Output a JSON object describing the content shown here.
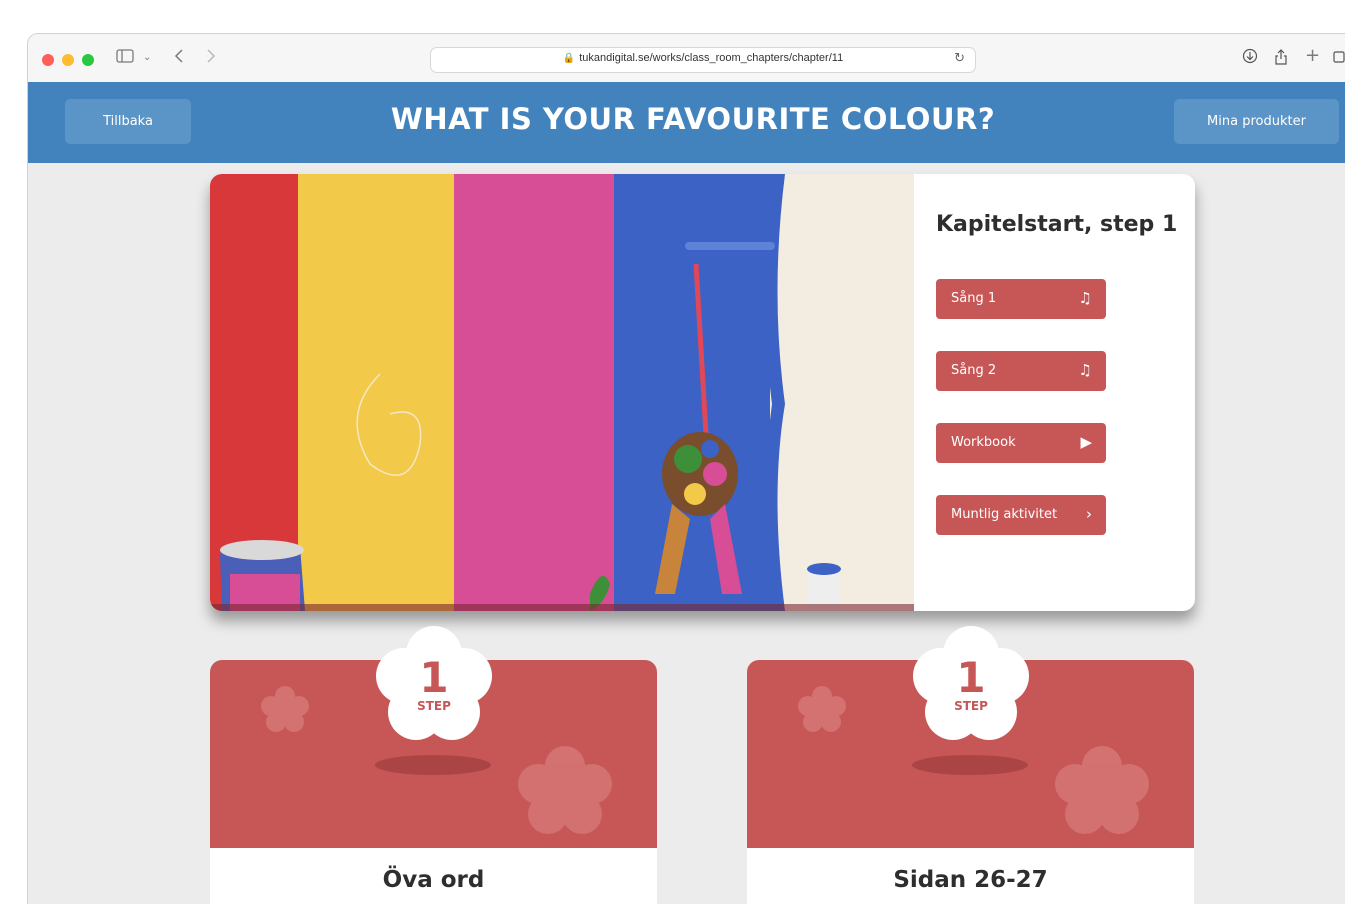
{
  "browser": {
    "url": "tukandigital.se/works/class_room_chapters/chapter/11"
  },
  "header": {
    "back_label": "Tillbaka",
    "title": "WHAT IS YOUR FAVOURITE COLOUR?",
    "products_label": "Mina produkter"
  },
  "hero": {
    "section_title": "Kapitelstart, step 1",
    "actions": [
      {
        "label": "Sång 1",
        "icon": "music-note-icon"
      },
      {
        "label": "Sång 2",
        "icon": "music-note-icon"
      },
      {
        "label": "Workbook",
        "icon": "play-icon"
      },
      {
        "label": "Muntlig aktivitet",
        "icon": "chevron-right-icon"
      }
    ]
  },
  "cards": [
    {
      "badge_number": "1",
      "badge_word": "STEP",
      "title": "Öva ord"
    },
    {
      "badge_number": "1",
      "badge_word": "STEP",
      "title": "Sidan 26-27"
    }
  ],
  "colors": {
    "header_blue": "#4383bd",
    "accent_red": "#c75757",
    "page_bg": "#ececec"
  }
}
